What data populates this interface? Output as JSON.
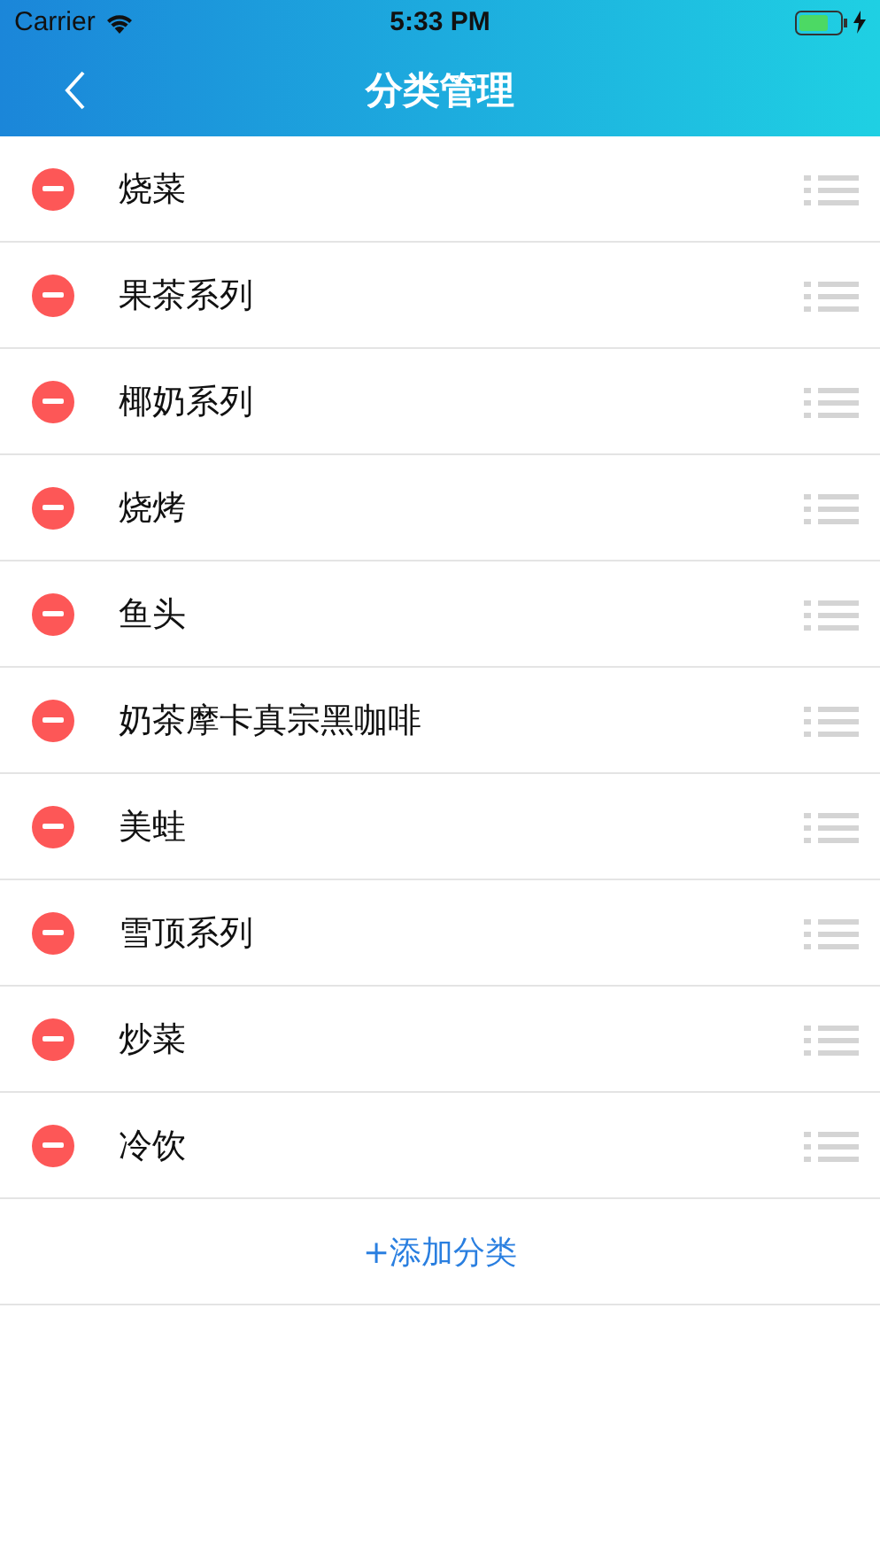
{
  "status_bar": {
    "carrier": "Carrier",
    "time": "5:33 PM"
  },
  "nav": {
    "title": "分类管理"
  },
  "categories": [
    {
      "name": "烧菜"
    },
    {
      "name": "果茶系列"
    },
    {
      "name": "椰奶系列"
    },
    {
      "name": "烧烤"
    },
    {
      "name": "鱼头"
    },
    {
      "name": "奶茶摩卡真宗黑咖啡"
    },
    {
      "name": "美蛙"
    },
    {
      "name": "雪顶系列"
    },
    {
      "name": "炒菜"
    },
    {
      "name": "冷饮"
    }
  ],
  "add_button": {
    "label": "+添加分类"
  }
}
